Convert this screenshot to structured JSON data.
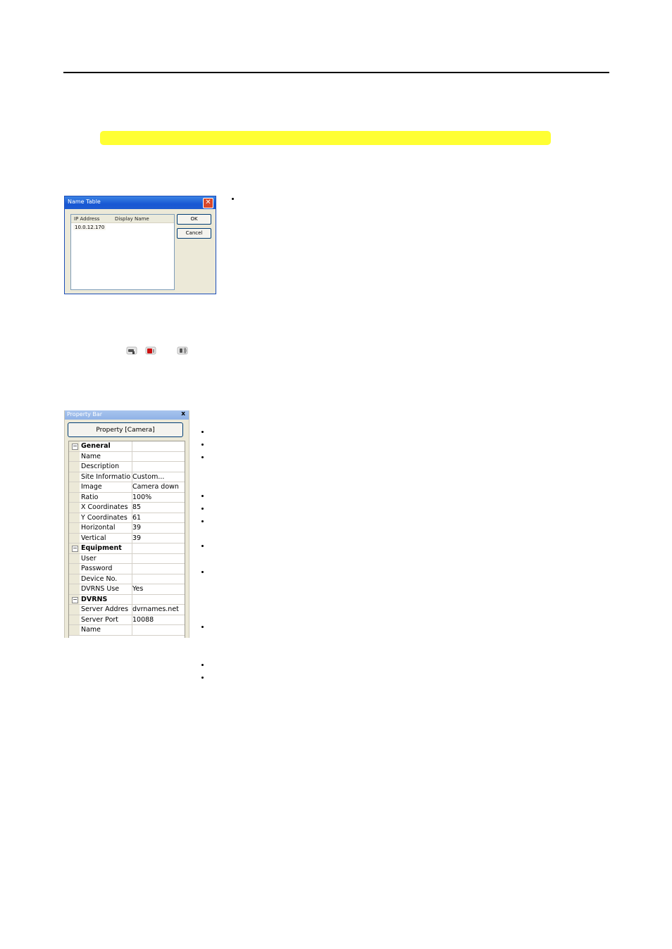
{
  "name_table": {
    "title": "Name Table",
    "close_glyph": "✕",
    "columns": [
      "IP Address",
      "Display Name"
    ],
    "rows": [
      [
        "10.0.12.170",
        ""
      ]
    ],
    "ok_label": "OK",
    "cancel_label": "Cancel"
  },
  "icons": [
    "camera-icon",
    "alarm-sensor-icon",
    "speaker-icon"
  ],
  "property_bar": {
    "title": "Property Bar",
    "close_glyph": "x",
    "property_button": "Property [Camera]",
    "expand_glyph": "−",
    "rows": [
      {
        "key": "General",
        "value": "",
        "category": true
      },
      {
        "key": "Name",
        "value": ""
      },
      {
        "key": "Description",
        "value": ""
      },
      {
        "key": "Site Informatio",
        "value": "Custom..."
      },
      {
        "key": "Image",
        "value": "Camera down"
      },
      {
        "key": "Ratio",
        "value": "100%"
      },
      {
        "key": "X Coordinates",
        "value": "85"
      },
      {
        "key": "Y Coordinates",
        "value": "61"
      },
      {
        "key": "Horizontal",
        "value": "39"
      },
      {
        "key": "Vertical",
        "value": "39"
      },
      {
        "key": "Equipment",
        "value": "",
        "category": true
      },
      {
        "key": "User",
        "value": ""
      },
      {
        "key": "Password",
        "value": ""
      },
      {
        "key": "Device No.",
        "value": ""
      },
      {
        "key": "DVRNS Use",
        "value": "Yes"
      },
      {
        "key": "DVRNS",
        "value": "",
        "category": true
      },
      {
        "key": "Server Addres",
        "value": "dvrnames.net"
      },
      {
        "key": "Server Port",
        "value": "10088"
      },
      {
        "key": "Name",
        "value": ""
      }
    ]
  },
  "colors": {
    "highlight": "#ffff33",
    "titlebar": "#1858d4",
    "dialog_bg": "#ece9d8"
  }
}
